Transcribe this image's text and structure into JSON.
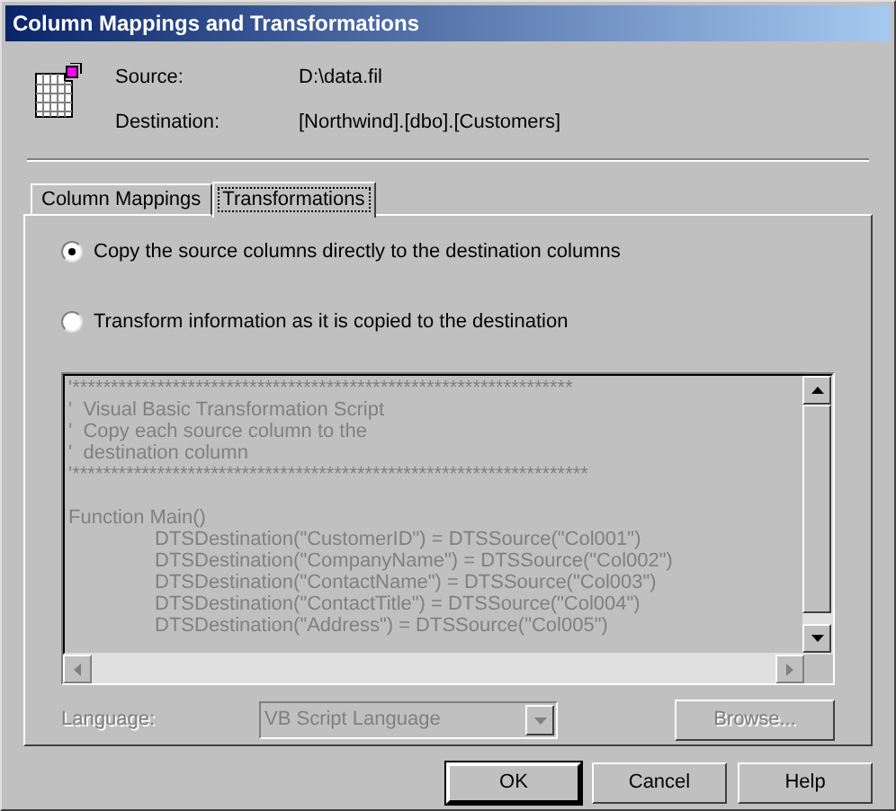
{
  "window": {
    "title": "Column Mappings and Transformations"
  },
  "header": {
    "fields": [
      {
        "label": "Source:",
        "value": "D:\\data.fil"
      },
      {
        "label": "Destination:",
        "value": "[Northwind].[dbo].[Customers]"
      }
    ]
  },
  "tabs": [
    {
      "label": "Column Mappings",
      "selected": false
    },
    {
      "label": "Transformations",
      "selected": true
    }
  ],
  "options": [
    {
      "label": "Copy the source columns directly to the destination columns",
      "selected": true
    },
    {
      "label": "Transform information as it is copied to the destination",
      "selected": false
    }
  ],
  "script_editor": {
    "disabled": true,
    "comment_lines": [
      "'*****************************************************************",
      "'  Visual Basic Transformation Script",
      "'  Copy each source column to the",
      "'  destination column",
      "'*******************************************************************"
    ],
    "code_lines": [
      "Function Main()",
      "\tDTSDestination(\"CustomerID\") = DTSSource(\"Col001\")",
      "\tDTSDestination(\"CompanyName\") = DTSSource(\"Col002\")",
      "\tDTSDestination(\"ContactName\") = DTSSource(\"Col003\")",
      "\tDTSDestination(\"ContactTitle\") = DTSSource(\"Col004\")",
      "\tDTSDestination(\"Address\") = DTSSource(\"Col005\")"
    ]
  },
  "language": {
    "label": "Language:",
    "value": "VB Script Language",
    "disabled": true
  },
  "browse_button": {
    "label": "Browse...",
    "disabled": true
  },
  "buttons": [
    {
      "label": "OK",
      "default": true
    },
    {
      "label": "Cancel",
      "default": false
    },
    {
      "label": "Help",
      "default": false
    }
  ]
}
